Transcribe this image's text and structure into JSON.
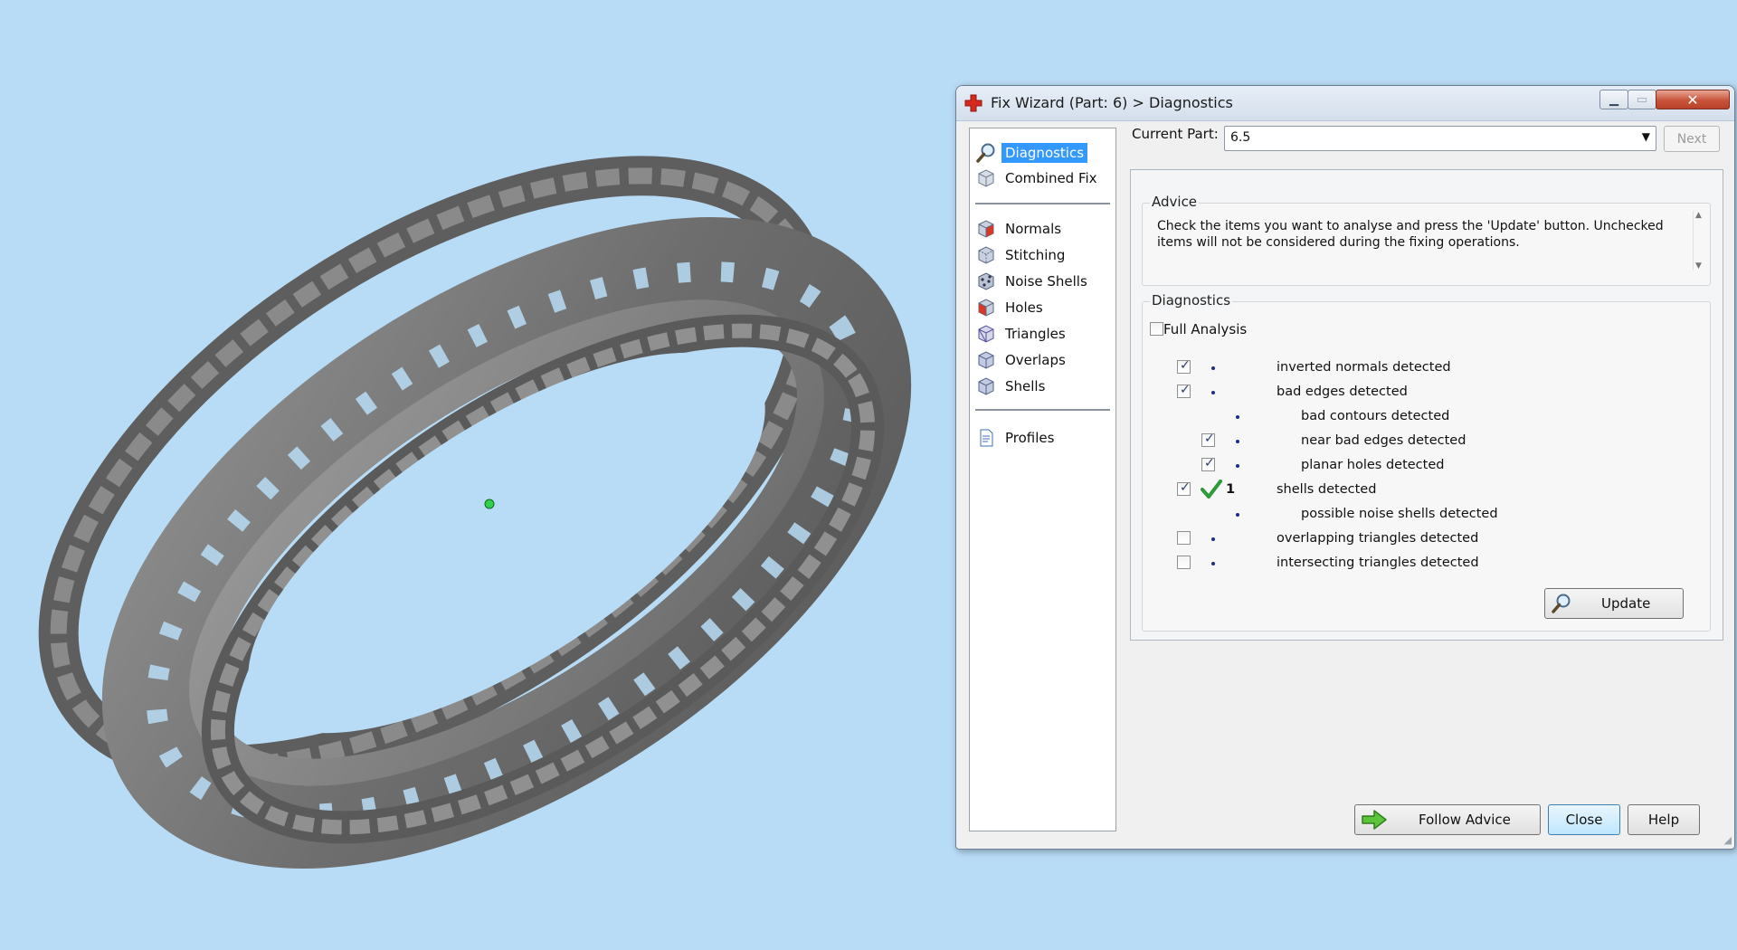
{
  "window": {
    "title": "Fix Wizard (Part: 6) > Diagnostics",
    "min_glyph": "▁",
    "max_glyph": "▭",
    "close_glyph": "✕"
  },
  "nav": {
    "items": [
      {
        "label": "Diagnostics",
        "icon": "magnifier-icon",
        "selected": true
      },
      {
        "label": "Combined Fix",
        "icon": "cube-icon"
      },
      {
        "label": "Normals",
        "icon": "cube-red-face-icon"
      },
      {
        "label": "Stitching",
        "icon": "cube-stitch-icon"
      },
      {
        "label": "Noise Shells",
        "icon": "cube-dots-icon"
      },
      {
        "label": "Holes",
        "icon": "cube-red-icon"
      },
      {
        "label": "Triangles",
        "icon": "cube-triangle-icon"
      },
      {
        "label": "Overlaps",
        "icon": "cube-overlap-icon"
      },
      {
        "label": "Shells",
        "icon": "cube-shells-icon"
      },
      {
        "label": "Profiles",
        "icon": "document-icon"
      }
    ]
  },
  "current_part": {
    "label": "Current Part:",
    "value": "6.5",
    "next_label": "Next"
  },
  "advice": {
    "title": "Advice",
    "text": "Check the items you want to analyse and press the 'Update' button. Unchecked items will not be considered during the fixing operations."
  },
  "diagnostics": {
    "title": "Diagnostics",
    "full_analysis_label": "Full Analysis",
    "full_analysis_checked": false,
    "rows": [
      {
        "label": "inverted normals detected",
        "checked": true,
        "has_checkbox": true,
        "indent": 0,
        "status": "dot",
        "count": ""
      },
      {
        "label": "bad edges detected",
        "checked": true,
        "has_checkbox": true,
        "indent": 0,
        "status": "dot",
        "count": ""
      },
      {
        "label": "bad contours detected",
        "checked": false,
        "has_checkbox": false,
        "indent": 1,
        "status": "dot",
        "count": ""
      },
      {
        "label": "near bad edges detected",
        "checked": true,
        "has_checkbox": true,
        "indent": 1,
        "status": "dot",
        "count": ""
      },
      {
        "label": "planar holes detected",
        "checked": true,
        "has_checkbox": true,
        "indent": 1,
        "status": "dot",
        "count": ""
      },
      {
        "label": "shells detected",
        "checked": true,
        "has_checkbox": true,
        "indent": 0,
        "status": "ok",
        "count": "1"
      },
      {
        "label": "possible noise shells detected",
        "checked": false,
        "has_checkbox": false,
        "indent": 1,
        "status": "dot",
        "count": ""
      },
      {
        "label": "overlapping triangles detected",
        "checked": false,
        "has_checkbox": true,
        "indent": 0,
        "status": "dot",
        "count": ""
      },
      {
        "label": "intersecting triangles detected",
        "checked": false,
        "has_checkbox": true,
        "indent": 0,
        "status": "dot",
        "count": ""
      }
    ],
    "update_label": "Update"
  },
  "buttons": {
    "follow_advice": "Follow Advice",
    "close": "Close",
    "help": "Help"
  },
  "colors": {
    "background": "#b9dcf6",
    "model_gray": "#7a7a7a",
    "selection_blue": "#3399ff",
    "ok_green": "#2e9a3a"
  }
}
